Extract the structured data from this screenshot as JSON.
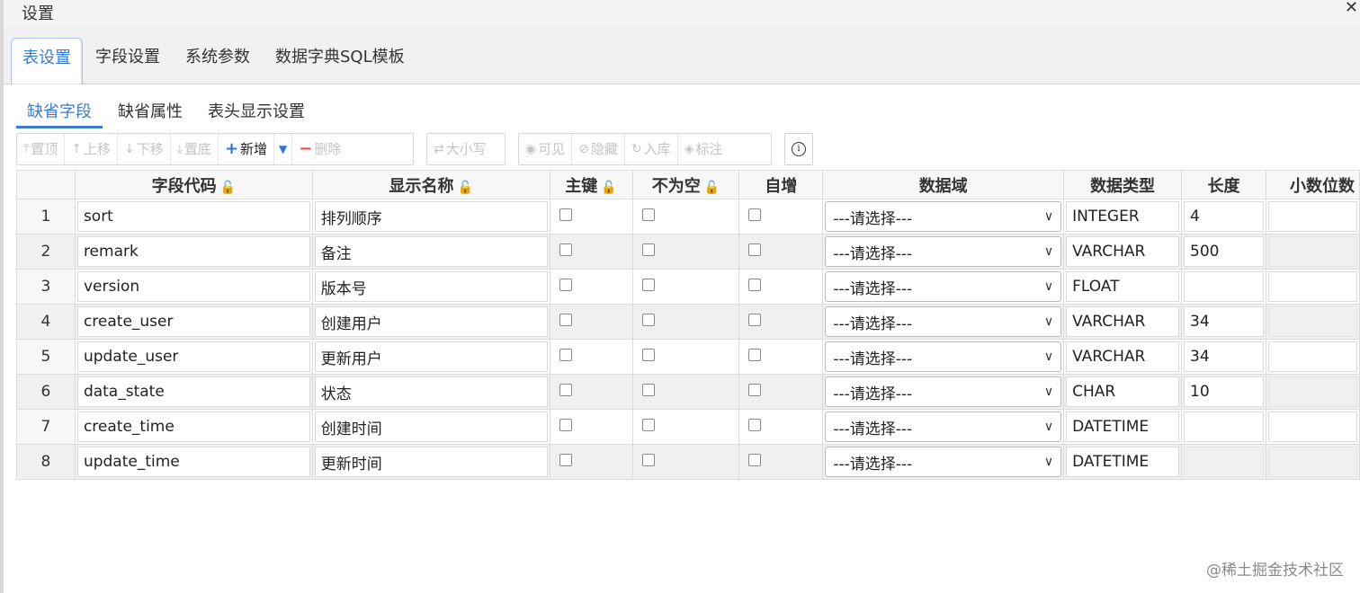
{
  "dialog": {
    "title": "设置",
    "close": "✕"
  },
  "tabs": [
    {
      "label": "表设置"
    },
    {
      "label": "字段设置"
    },
    {
      "label": "系统参数"
    },
    {
      "label": "数据字典SQL模板"
    }
  ],
  "subtabs": [
    {
      "label": "缺省字段"
    },
    {
      "label": "缺省属性"
    },
    {
      "label": "表头显示设置"
    }
  ],
  "toolbar": {
    "top": "置顶",
    "up": "上移",
    "down": "下移",
    "bottom": "置底",
    "add": "新增",
    "delete": "删除",
    "case": "大小写",
    "visible": "可见",
    "hide": "隐藏",
    "import": "入库",
    "annotate": "标注",
    "info": "i"
  },
  "columns": {
    "code": "字段代码",
    "name": "显示名称",
    "pk": "主键",
    "notnull": "不为空",
    "autoinc": "自增",
    "domain": "数据域",
    "type": "数据类型",
    "length": "长度",
    "decimal": "小数位数"
  },
  "select_placeholder": "---请选择---",
  "rows": [
    {
      "num": "1",
      "code": "sort",
      "name": "排列顺序",
      "type": "INTEGER",
      "length": "4"
    },
    {
      "num": "2",
      "code": "remark",
      "name": "备注",
      "type": "VARCHAR",
      "length": "500"
    },
    {
      "num": "3",
      "code": "version",
      "name": "版本号",
      "type": "FLOAT",
      "length": ""
    },
    {
      "num": "4",
      "code": "create_user",
      "name": "创建用户",
      "type": "VARCHAR",
      "length": "34"
    },
    {
      "num": "5",
      "code": "update_user",
      "name": "更新用户",
      "type": "VARCHAR",
      "length": "34"
    },
    {
      "num": "6",
      "code": "data_state",
      "name": "状态",
      "type": "CHAR",
      "length": "10"
    },
    {
      "num": "7",
      "code": "create_time",
      "name": "创建时间",
      "type": "DATETIME",
      "length": ""
    },
    {
      "num": "8",
      "code": "update_time",
      "name": "更新时间",
      "type": "DATETIME",
      "length": ""
    }
  ],
  "watermark": "@稀土掘金技术社区",
  "accent": "#3a7bd5"
}
